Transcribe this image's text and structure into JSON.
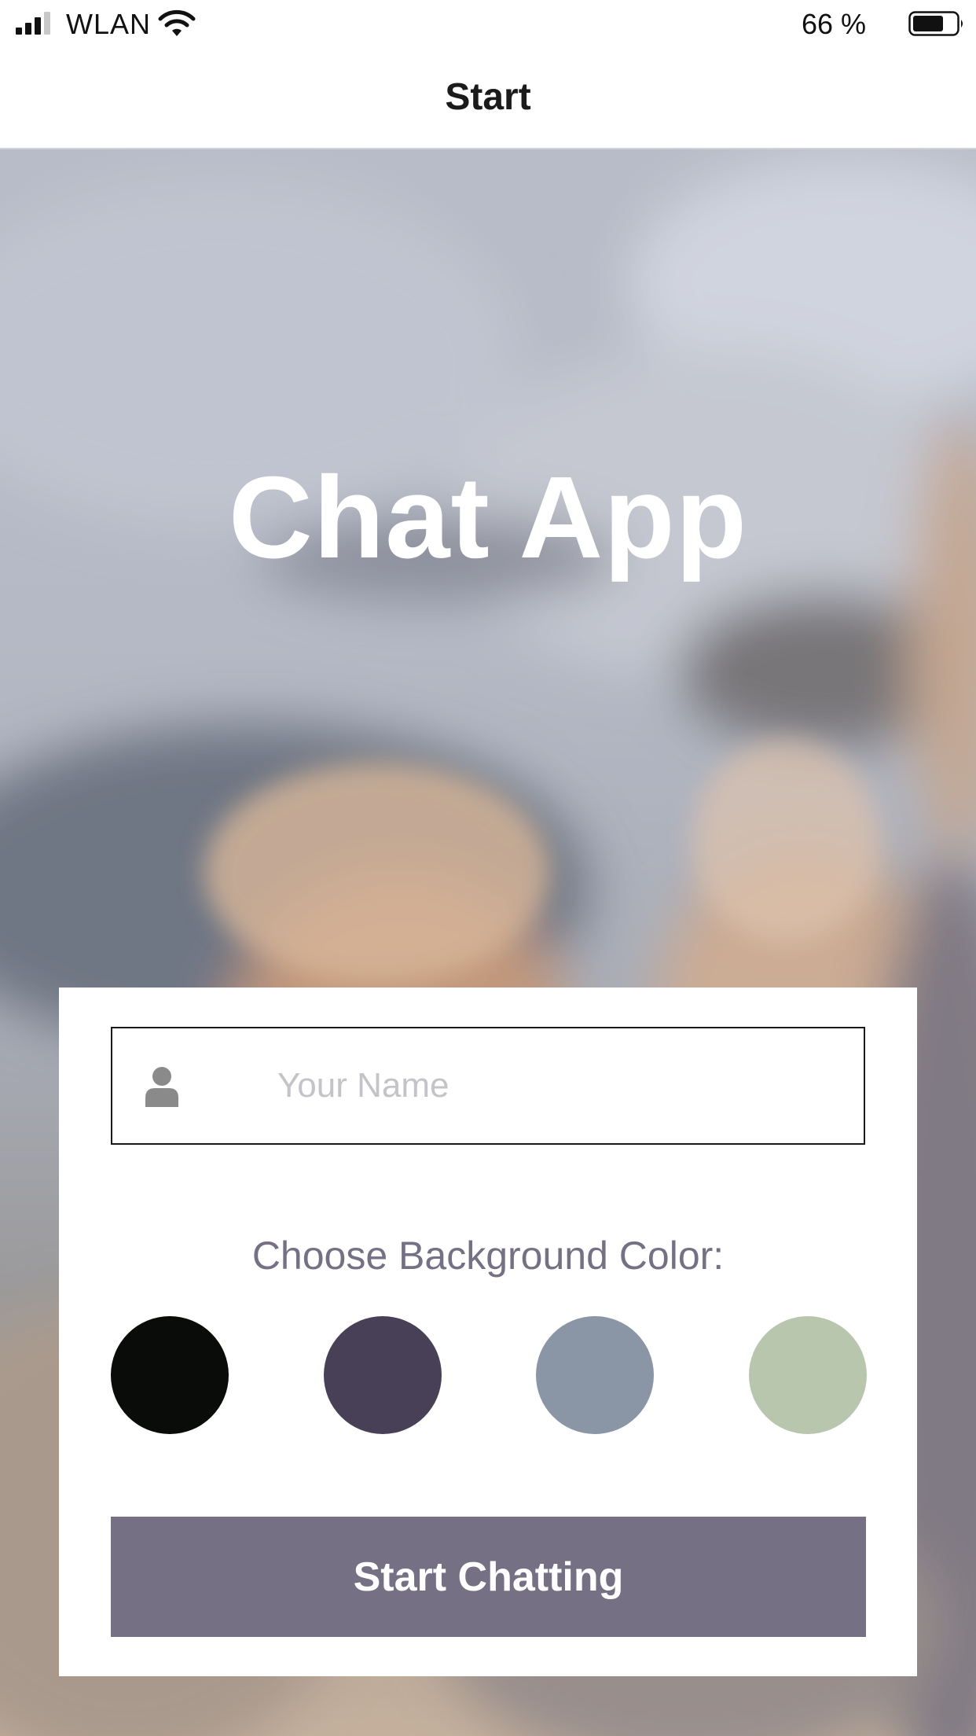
{
  "status_bar": {
    "carrier": "WLAN",
    "battery_percent": "66 %",
    "icons": [
      "signal-icon",
      "wifi-icon",
      "battery-icon"
    ]
  },
  "nav": {
    "title": "Start"
  },
  "hero": {
    "title": "Chat App"
  },
  "login": {
    "name_placeholder": "Your Name",
    "name_value": "",
    "name_icon": "user-icon",
    "color_label": "Choose Background Color:",
    "colors": [
      "#090C08",
      "#474056",
      "#8A95A5",
      "#B9C6AE"
    ],
    "start_label": "Start Chatting"
  },
  "theme": {
    "accent": "#757083",
    "text": "#1B1B1B"
  }
}
